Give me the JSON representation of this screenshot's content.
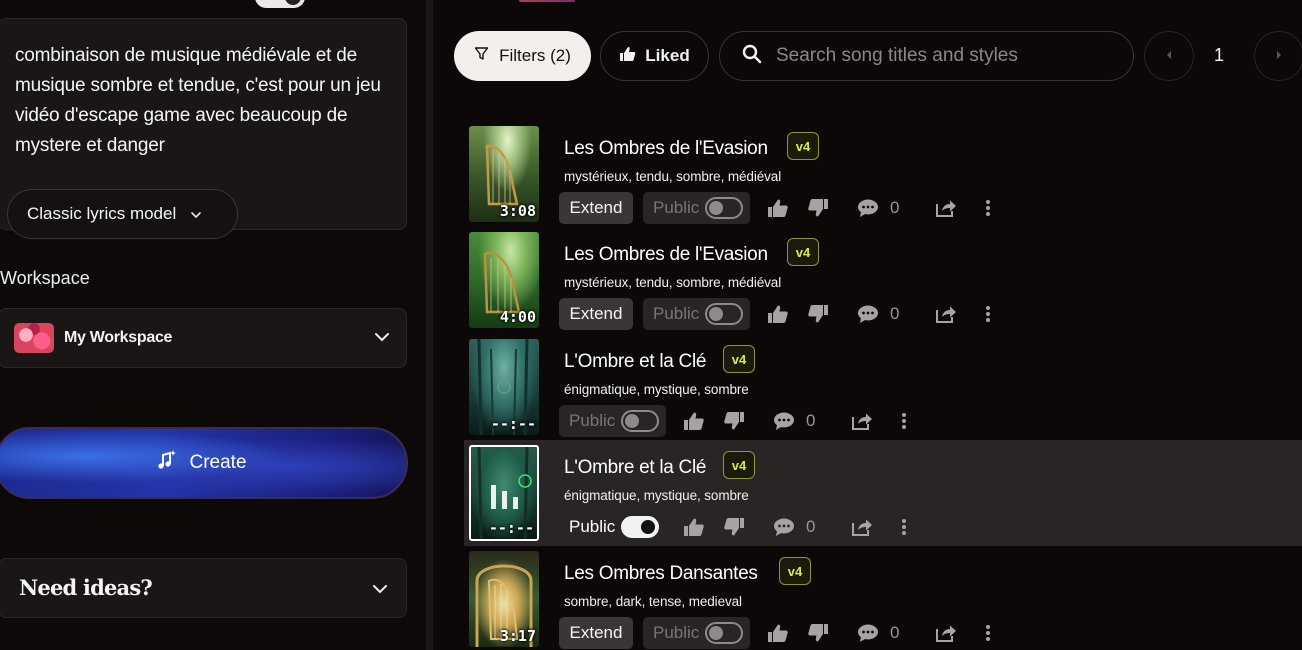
{
  "left": {
    "prompt_text": " combinaison de musique médiévale et de musique sombre et tendue, c'est pour un jeu vidéo d'escape game avec beaucoup de mystere et danger",
    "lyrics_model_label": "Classic lyrics model",
    "workspace_label": "Workspace",
    "workspace_name": "My Workspace",
    "create_label": "Create",
    "ideas_label": "Need ideas?"
  },
  "toolbar": {
    "filters_label": "Filters (2)",
    "liked_label": "Liked",
    "search_placeholder": "Search song titles and styles",
    "page_number": "1"
  },
  "songs": [
    {
      "title": "Les Ombres de l'Evasion",
      "version": "v4",
      "tags": "mystérieux, tendu, sombre, médiéval",
      "duration": "3:08",
      "extend_label": "Extend",
      "public_label": "Public",
      "public": false,
      "comments": "0",
      "active": false
    },
    {
      "title": "Les Ombres de l'Evasion",
      "version": "v4",
      "tags": "mystérieux, tendu, sombre, médiéval",
      "duration": "4:00",
      "extend_label": "Extend",
      "public_label": "Public",
      "public": false,
      "comments": "0",
      "active": false
    },
    {
      "title": "L'Ombre et la Clé",
      "version": "v4",
      "tags": "énigmatique, mystique, sombre",
      "duration": "--:--",
      "extend_label": "",
      "public_label": "Public",
      "public": false,
      "comments": "0",
      "active": false
    },
    {
      "title": "L'Ombre et la Clé",
      "version": "v4",
      "tags": "énigmatique, mystique, sombre",
      "duration": "--:--",
      "extend_label": "",
      "public_label": "Public",
      "public": true,
      "comments": "0",
      "active": true
    },
    {
      "title": "Les Ombres Dansantes",
      "version": "v4",
      "tags": "sombre, dark, tense, medieval",
      "duration": "3:17",
      "extend_label": "Extend",
      "public_label": "Public",
      "public": false,
      "comments": "0",
      "active": false
    }
  ],
  "colors": {
    "badge": "#d6ee3b",
    "create_gradient_start": "#3a6fe6",
    "create_gradient_end": "#15165a"
  }
}
